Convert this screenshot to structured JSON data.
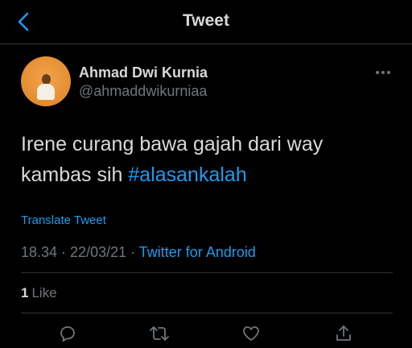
{
  "header": {
    "title": "Tweet",
    "back_icon": "back-arrow-icon"
  },
  "author": {
    "name": "Ahmad Dwi Kurnia",
    "handle": "@ahmaddwikurniaa",
    "more_icon": "more-options-icon"
  },
  "tweet": {
    "text_plain": "Irene curang bawa gajah dari way kambas sih ",
    "hashtag": "#alasankalah",
    "translate_label": "Translate Tweet",
    "time": "18.34",
    "date": "22/03/21",
    "separator1": " · ",
    "separator2": " · ",
    "source": "Twitter for Android"
  },
  "stats": {
    "likes_count": "1",
    "likes_label": "Like"
  },
  "actions": [
    {
      "name": "reply",
      "icon": "reply-icon"
    },
    {
      "name": "retweet",
      "icon": "retweet-icon"
    },
    {
      "name": "like",
      "icon": "heart-icon"
    },
    {
      "name": "share",
      "icon": "share-icon"
    }
  ],
  "colors": {
    "background": "#000000",
    "text": "#d9d9d9",
    "secondary": "#6e767d",
    "accent": "#1d9bf0",
    "divider": "#2f3336"
  }
}
